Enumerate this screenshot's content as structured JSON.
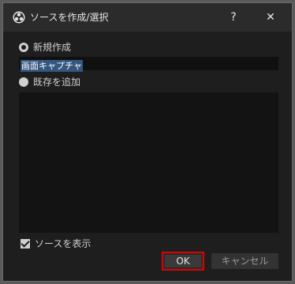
{
  "dialog": {
    "title": "ソースを作成/選択",
    "help_label": "?",
    "close_label": "✕"
  },
  "options": {
    "new_label": "新規作成",
    "new_selected": true,
    "name_value": "画面キャプチャ",
    "existing_label": "既存を追加",
    "existing_selected": false
  },
  "existing_sources": [],
  "visibility": {
    "show_source_label": "ソースを表示",
    "checked": true
  },
  "buttons": {
    "ok_label": "OK",
    "cancel_label": "キャンセル"
  },
  "colors": {
    "highlight": "#e00000",
    "selection": "#34567f"
  }
}
